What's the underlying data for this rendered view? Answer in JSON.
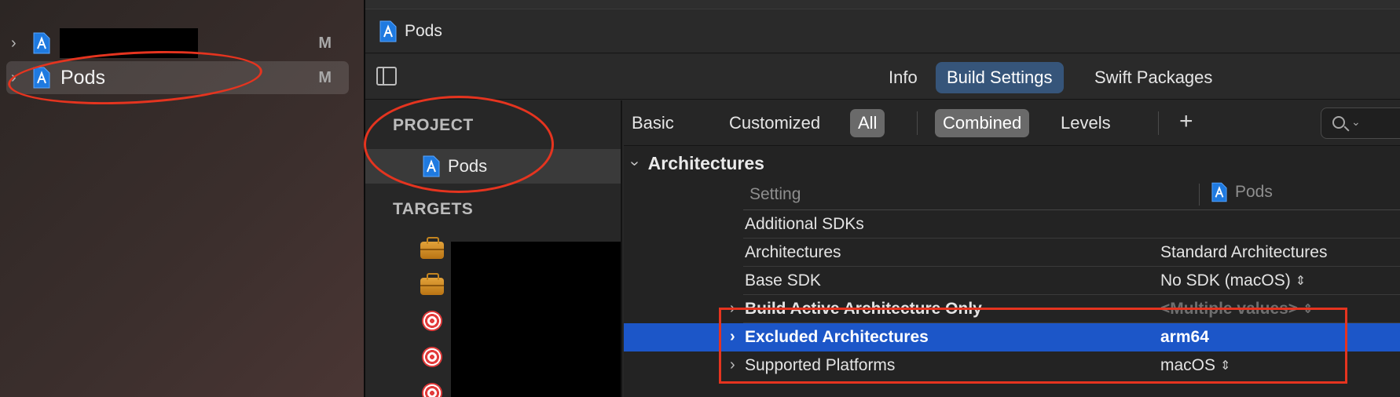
{
  "navigator": {
    "items": [
      {
        "name": "",
        "badge": "M",
        "redacted": true
      },
      {
        "name": "Pods",
        "badge": "M",
        "selected": true
      }
    ]
  },
  "jumpbar": {
    "crumb": "Pods"
  },
  "tabs": [
    {
      "label": "Info"
    },
    {
      "label": "Build Settings",
      "active": true
    },
    {
      "label": "Swift Packages"
    }
  ],
  "project_list": {
    "project_header": "PROJECT",
    "project_item": "Pods",
    "targets_header": "TARGETS"
  },
  "filters": {
    "basic": "Basic",
    "customized": "Customized",
    "all": "All",
    "combined": "Combined",
    "levels": "Levels",
    "add": "+"
  },
  "settings": {
    "group_title": "Architectures",
    "column_setting": "Setting",
    "column_target": "Pods",
    "rows": [
      {
        "setting": "Additional SDKs",
        "value": ""
      },
      {
        "setting": "Architectures",
        "value": "Standard Architectures"
      },
      {
        "setting": "Base SDK",
        "value": "No SDK (macOS)"
      },
      {
        "setting": "Build Active Architecture Only",
        "value": "<Multiple values>"
      },
      {
        "setting": "Excluded Architectures",
        "value": "arm64"
      },
      {
        "setting": "Supported Platforms",
        "value": "macOS"
      }
    ]
  },
  "colors": {
    "selection": "#1c56c8",
    "active_tab": "#36557a",
    "annotation": "#e5341f"
  }
}
